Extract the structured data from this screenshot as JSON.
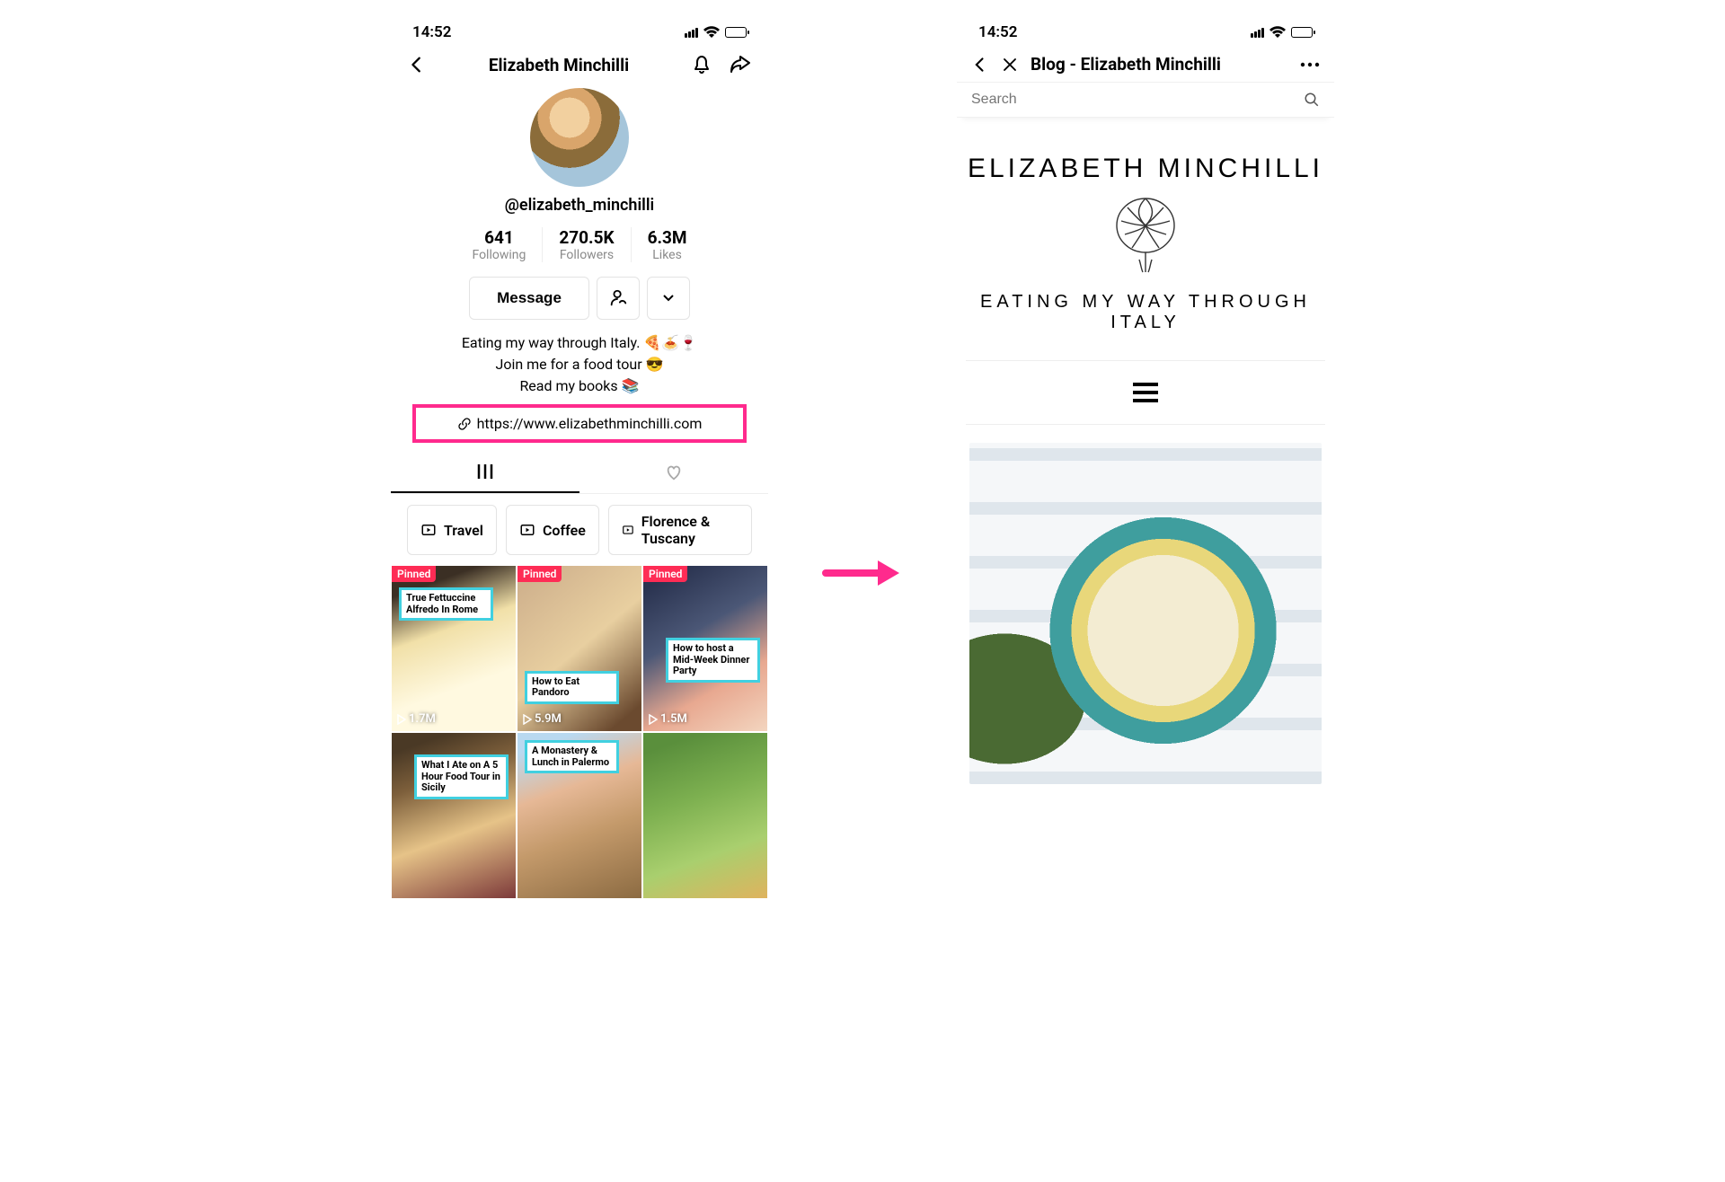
{
  "status": {
    "time": "14:52"
  },
  "left": {
    "header": {
      "title": "Elizabeth Minchilli"
    },
    "username": "@elizabeth_minchilli",
    "stats": {
      "following": {
        "value": "641",
        "label": "Following"
      },
      "followers": {
        "value": "270.5K",
        "label": "Followers"
      },
      "likes": {
        "value": "6.3M",
        "label": "Likes"
      }
    },
    "actions": {
      "message": "Message"
    },
    "bio": {
      "line1": "Eating my way through Italy. 🍕🍝🍷",
      "line2": "Join me for a food tour 😎",
      "line3": "Read my books 📚"
    },
    "link": "https://www.elizabethminchilli.com",
    "playlists": [
      "Travel",
      "Coffee",
      "Florence & Tuscany"
    ],
    "pinned_label": "Pinned",
    "tiles": [
      {
        "caption": "True Fettuccine Alfredo In Rome",
        "views": "1.7M",
        "pinned": true
      },
      {
        "caption": "How to Eat Pandoro",
        "views": "5.9M",
        "pinned": true
      },
      {
        "caption": "How to host a Mid-Week Dinner Party",
        "views": "1.5M",
        "pinned": true
      },
      {
        "caption": "What I Ate on A 5 Hour Food Tour in Sicily",
        "views": "",
        "pinned": false
      },
      {
        "caption": "A Monastery & Lunch in Palermo",
        "views": "",
        "pinned": false
      },
      {
        "caption": "",
        "views": "",
        "pinned": false
      }
    ]
  },
  "right": {
    "header": {
      "title": "Blog - Elizabeth Minchilli"
    },
    "search": {
      "placeholder": "Search"
    },
    "logo": {
      "name": "ELIZABETH MINCHILLI",
      "tagline": "EATING MY WAY THROUGH ITALY"
    }
  }
}
